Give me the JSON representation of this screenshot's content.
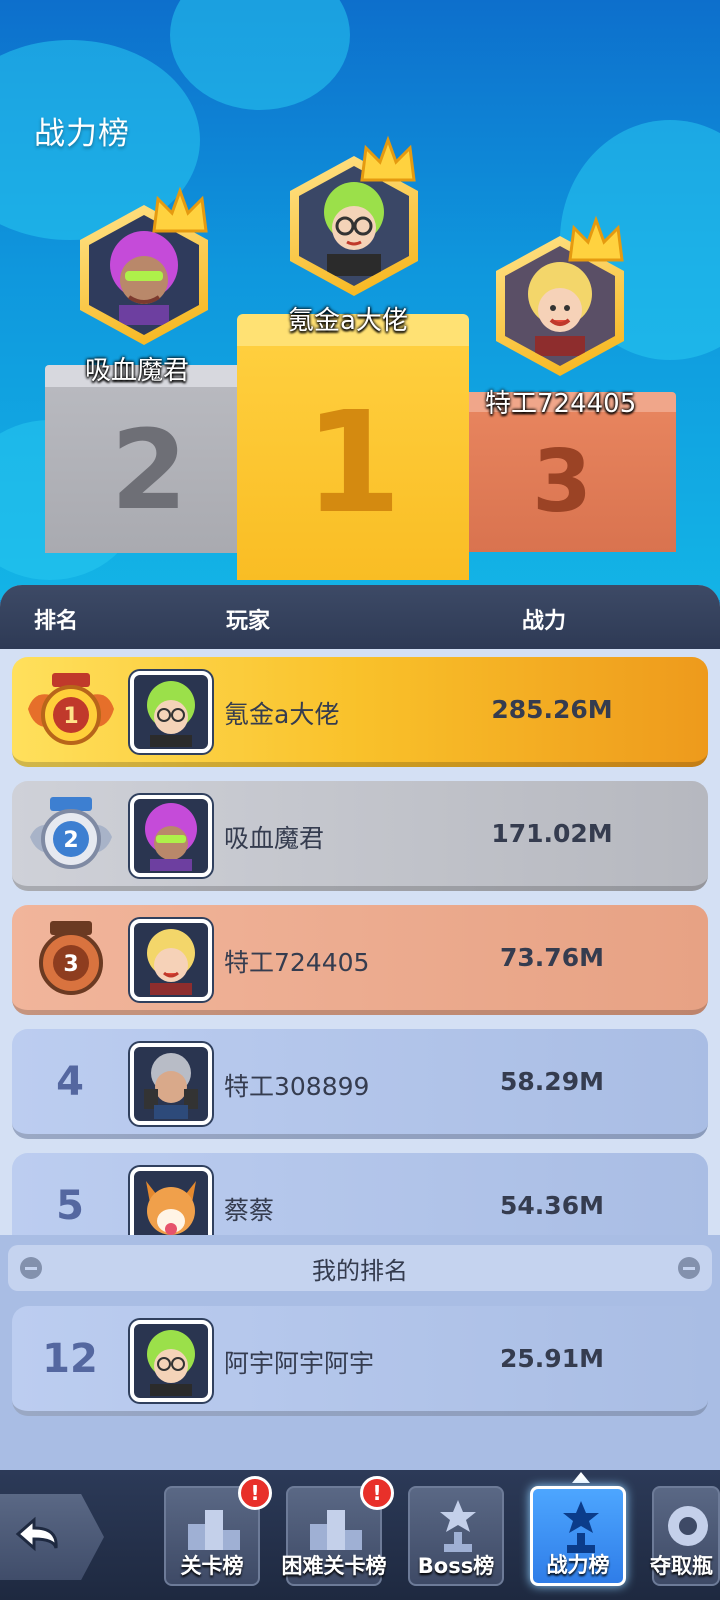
{
  "page": {
    "title": "战力榜"
  },
  "podium": [
    {
      "rank": "1",
      "name": "氪金a大佬",
      "hair": "#9be04a",
      "skin": "#f4d3b8"
    },
    {
      "rank": "2",
      "name": "吸血魔君",
      "hair": "#c54bd9",
      "skin": "#b9886a"
    },
    {
      "rank": "3",
      "name": "特工724405",
      "hair": "#f3d66a",
      "skin": "#f6d2b8"
    }
  ],
  "table": {
    "headers": {
      "rank": "排名",
      "player": "玩家",
      "power": "战力"
    },
    "rows": [
      {
        "rank": "1",
        "name": "氪金a大佬",
        "power": "285.26M"
      },
      {
        "rank": "2",
        "name": "吸血魔君",
        "power": "171.02M"
      },
      {
        "rank": "3",
        "name": "特工724405",
        "power": "73.76M"
      },
      {
        "rank": "4",
        "name": "特工308899",
        "power": "58.29M"
      },
      {
        "rank": "5",
        "name": "蔡蔡",
        "power": "54.36M"
      }
    ],
    "my_rank_label": "我的排名",
    "my_row": {
      "rank": "12",
      "name": "阿宇阿宇阿宇",
      "power": "25.91M"
    }
  },
  "nav": {
    "tabs": [
      {
        "label": "关卡榜",
        "badge": "!"
      },
      {
        "label": "困难关卡榜",
        "badge": "!"
      },
      {
        "label": "Boss榜"
      },
      {
        "label": "战力榜"
      },
      {
        "label": "夺取瓶"
      }
    ]
  },
  "colors": {
    "gold": "#f9c12a",
    "silver": "#b6b8bf",
    "bronze": "#e7a284",
    "accent": "#2f7de8"
  }
}
